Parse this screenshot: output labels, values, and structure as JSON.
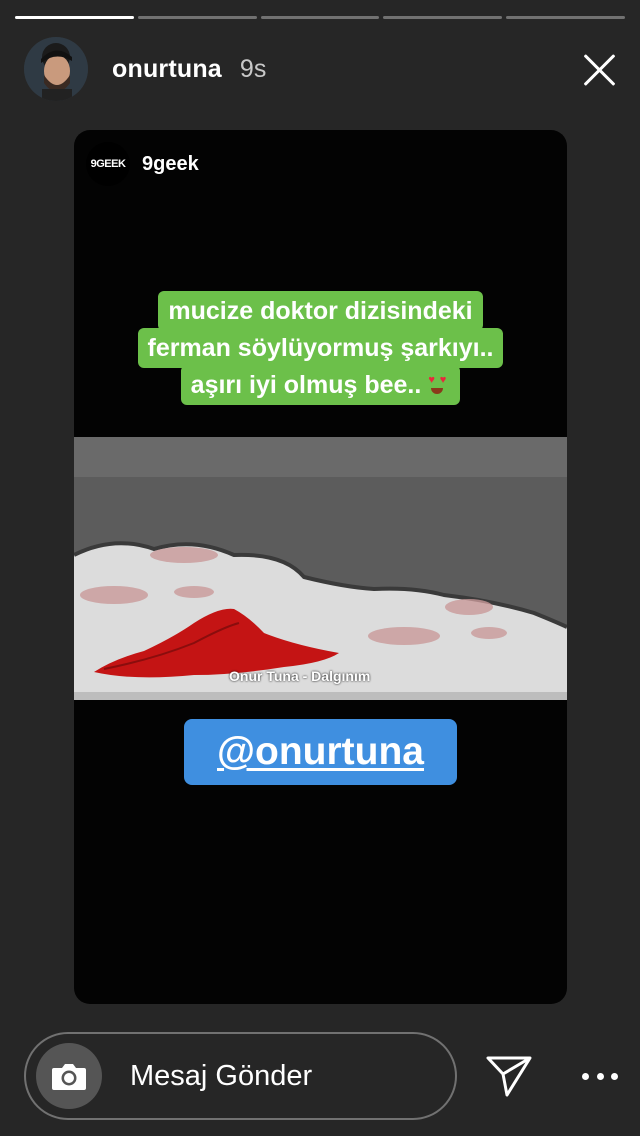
{
  "story": {
    "progress_segments": [
      1.0,
      0.0,
      0.0,
      0.0,
      0.0
    ],
    "username": "onurtuna",
    "time_ago": "9s"
  },
  "repost": {
    "logo_text": "9GEEK",
    "account": "9geek",
    "caption_lines": [
      "mucize doktor dizisindeki",
      "ferman söylüyormuş şarkıyı..",
      "aşırı iyi olmuş bee.."
    ],
    "caption_emoji": "heart-eyes-emoji",
    "video_caption": "Onur Tuna - Dalgınım",
    "mention": "@onurtuna"
  },
  "footer": {
    "message_placeholder": "Mesaj Gönder",
    "icons": [
      "camera-icon",
      "send-icon",
      "more-icon"
    ]
  },
  "colors": {
    "caption_bg": "#6cc04a",
    "mention_bg": "#3f8fe0",
    "background": "#262626"
  }
}
